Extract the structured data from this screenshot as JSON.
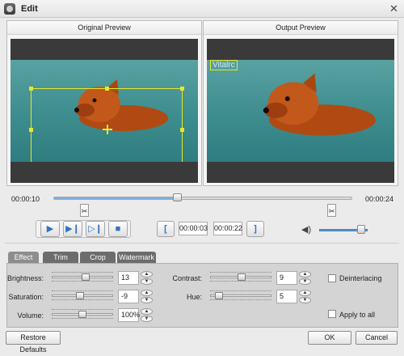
{
  "window": {
    "title": "Edit",
    "close_icon": "close-icon",
    "app_icon": "app-icon"
  },
  "previews": {
    "original_title": "Original Preview",
    "output_title": "Output Preview",
    "watermark_text": "Vitalrc"
  },
  "playback": {
    "current_time": "00:00:10",
    "total_time": "00:00:24",
    "seek_fraction": 0.42,
    "start_time": "00:00:03",
    "end_time": "00:00:22",
    "volume_fraction": 0.8
  },
  "tabs": [
    {
      "label": "Effect",
      "active": true
    },
    {
      "label": "Trim",
      "active": false
    },
    {
      "label": "Crop",
      "active": false
    },
    {
      "label": "Watermark",
      "active": false
    }
  ],
  "effect": {
    "brightness": {
      "label": "Brightness:",
      "value": "13"
    },
    "saturation": {
      "label": "Saturation:",
      "value": "-9"
    },
    "volume": {
      "label": "Volume:",
      "value": "100%"
    },
    "contrast": {
      "label": "Contrast:",
      "value": "9"
    },
    "hue": {
      "label": "Hue:",
      "value": "5"
    },
    "deinterlacing": {
      "label": "Deinterlacing",
      "checked": false
    },
    "apply_all": {
      "label": "Apply to all",
      "checked": false
    }
  },
  "buttons": {
    "restore": "Restore Defaults",
    "ok": "OK",
    "cancel": "Cancel"
  },
  "colors": {
    "accent": "#2f74c4",
    "crop": "#e7e72a"
  }
}
